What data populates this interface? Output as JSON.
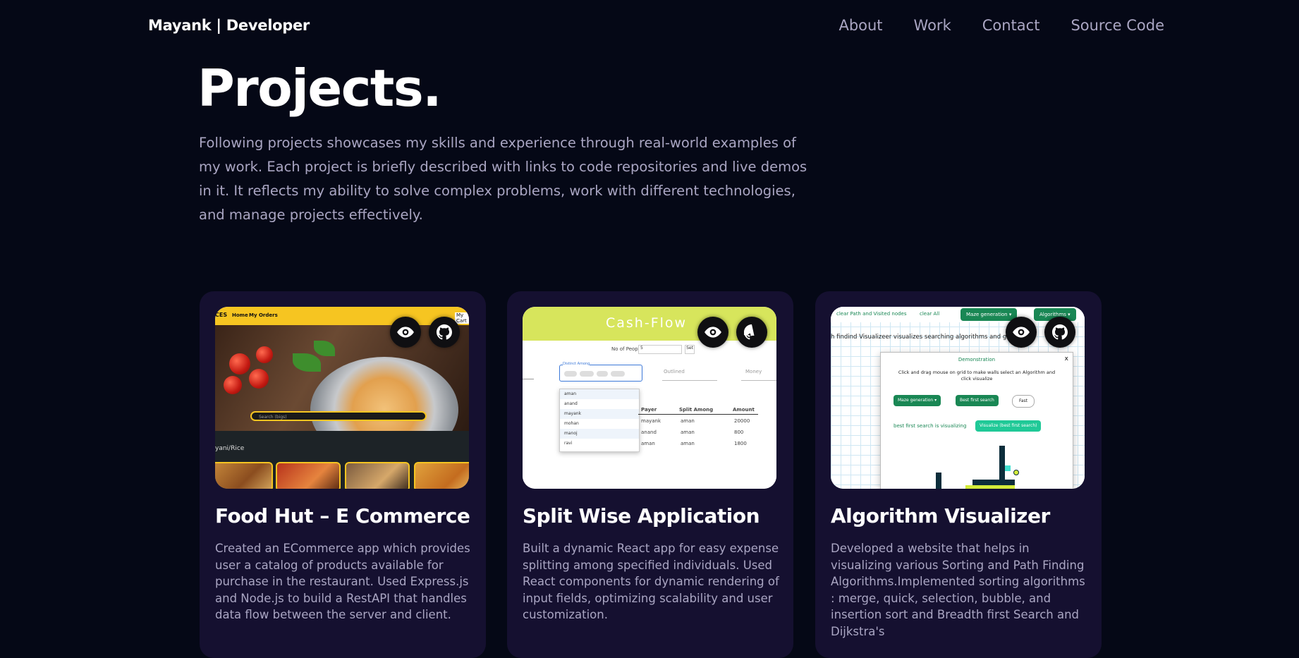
{
  "navbar": {
    "brand": "Mayank | Developer",
    "links": [
      "About",
      "Work",
      "Contact",
      "Source Code"
    ]
  },
  "header": {
    "title": "Projects.",
    "intro": "Following projects showcases my skills and experience through real-world examples of my work. Each project is briefly described with links to code repositories and live demos in it. It reflects my ability to solve complex problems, work with different technologies, and manage projects effectively."
  },
  "projects": [
    {
      "title": "Food Hut – E Commerce",
      "description": "Created an ECommerce app which provides user a catalog of products available for purchase in the restaurant. Used Express.js and Node.js to build a RestAPI that handles data flow between the server and client.",
      "thumbnail": {
        "nav_home": "Home",
        "nav_orders": "My Orders",
        "nav_cart": "My Cart",
        "logo_fragment": "CES",
        "search_placeholder": "Search (bigs)",
        "category": "yani/Rice"
      }
    },
    {
      "title": "Split Wise Application",
      "description": "Built a dynamic React app for easy expense splitting among specified individuals. Used React components for dynamic rendering of input fields, optimizing scalability and user customization.",
      "thumbnail": {
        "brand": "Cash-Flow",
        "people_label": "No of People:",
        "people_value": "5",
        "set_button": "Set",
        "chips_label": "Distinct Among",
        "field_outlined": "Outlined",
        "field_money": "Money",
        "dropdown_items": [
          "aman",
          "anand",
          "mayank",
          "mohan",
          "manoj",
          "ravi"
        ],
        "col_payer": "Payer",
        "col_split": "Split Among",
        "col_amount": "Amount",
        "rows": [
          {
            "payer": "mayank",
            "split": "aman",
            "amount": "20000"
          },
          {
            "payer": "anand",
            "split": "aman",
            "amount": "800"
          },
          {
            "payer": "aman",
            "split": "aman",
            "amount": "1800"
          }
        ]
      }
    },
    {
      "title": "Algorithm Visualizer",
      "description": "Developed a website that helps in visualizing various Sorting and Path Finding Algorithms.Implemented sorting algorithms : merge, quick, selection, bubble, and insertion sort and Breadth first Search and Dijkstra's",
      "thumbnail": {
        "clear_path": "clear Path and Visited nodes",
        "clear_all": "clear All",
        "maze_button": "Maze generation ▾",
        "algorithms_button": "Algorithms ▾",
        "tagline": "h findind Visualizeer visualizes searching algorithms and give you",
        "modal_title": "Demonstration",
        "modal_text": "Click and drag mouse on grid to make walls select an Algorithm and click visualize",
        "bfs_button": "Best first search",
        "fast_button": "Fast",
        "status": "best first search is visualizing",
        "visualize_button": "Visualize (best first search)",
        "close": "x"
      }
    }
  ],
  "colors": {
    "background": "#050816",
    "card": "#151030",
    "secondary_text": "#aaa6c3"
  }
}
